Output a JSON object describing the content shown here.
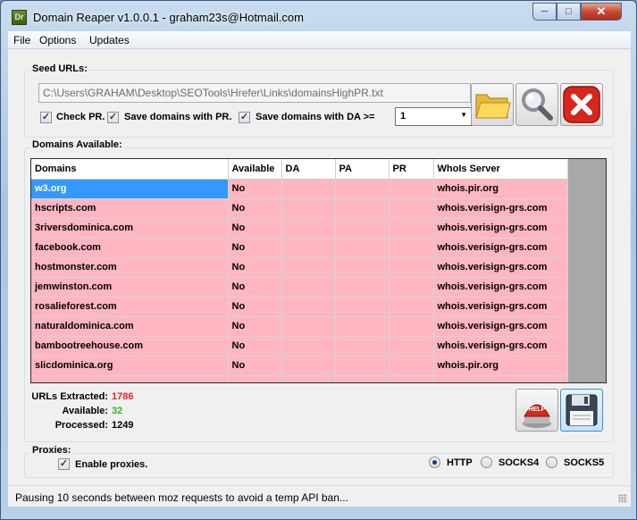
{
  "window": {
    "title": "Domain Reaper v1.0.0.1 - graham23s@Hotmail.com",
    "icon_text": "Dr"
  },
  "menu": {
    "items": [
      "File",
      "Options",
      "Updates"
    ]
  },
  "seed": {
    "group_label": "Seed URLs:",
    "path_value": "C:\\Users\\GRAHAM\\Desktop\\SEOTools\\Hrefer\\Links\\domainsHighPR.txt",
    "check_pr_label": "Check PR.",
    "check_pr": true,
    "save_pr_label": "Save domains with PR.",
    "save_pr": true,
    "save_da_label": "Save domains with DA >=",
    "save_da": true,
    "da_select_value": "1"
  },
  "domains": {
    "group_label": "Domains Available:",
    "columns": [
      "Domains",
      "Available",
      "DA",
      "PA",
      "PR",
      "WhoIs Server"
    ],
    "rows": [
      [
        "w3.org",
        "No",
        "",
        "",
        "",
        "whois.pir.org"
      ],
      [
        "hscripts.com",
        "No",
        "",
        "",
        "",
        "whois.verisign-grs.com"
      ],
      [
        "3riversdominica.com",
        "No",
        "",
        "",
        "",
        "whois.verisign-grs.com"
      ],
      [
        "facebook.com",
        "No",
        "",
        "",
        "",
        "whois.verisign-grs.com"
      ],
      [
        "hostmonster.com",
        "No",
        "",
        "",
        "",
        "whois.verisign-grs.com"
      ],
      [
        "jemwinston.com",
        "No",
        "",
        "",
        "",
        "whois.verisign-grs.com"
      ],
      [
        "rosalieforest.com",
        "No",
        "",
        "",
        "",
        "whois.verisign-grs.com"
      ],
      [
        "naturaldominica.com",
        "No",
        "",
        "",
        "",
        "whois.verisign-grs.com"
      ],
      [
        "bambootreehouse.com",
        "No",
        "",
        "",
        "",
        "whois.verisign-grs.com"
      ],
      [
        "slicdominica.org",
        "No",
        "",
        "",
        "",
        "whois.pir.org"
      ]
    ]
  },
  "stats": {
    "extracted_label": "URLs Extracted:",
    "extracted": "1786",
    "available_label": "Available:",
    "available": "32",
    "processed_label": "Processed:",
    "processed": "1249",
    "extracted_color": "#e8261a",
    "available_color": "#28b828"
  },
  "proxies": {
    "group_label": "Proxies:",
    "enable_label": "Enable proxies.",
    "enable": true,
    "options": [
      "HTTP",
      "SOCKS4",
      "SOCKS5"
    ],
    "selected": "HTTP"
  },
  "status": {
    "text": "Pausing 10 seconds between moz requests to avoid a temp API ban..."
  },
  "icons": {
    "open": "folder-icon",
    "search": "magnifier-icon",
    "cancel": "cancel-icon",
    "help": "help-icon",
    "save": "floppy-disk-icon",
    "help_text": "HELP"
  }
}
